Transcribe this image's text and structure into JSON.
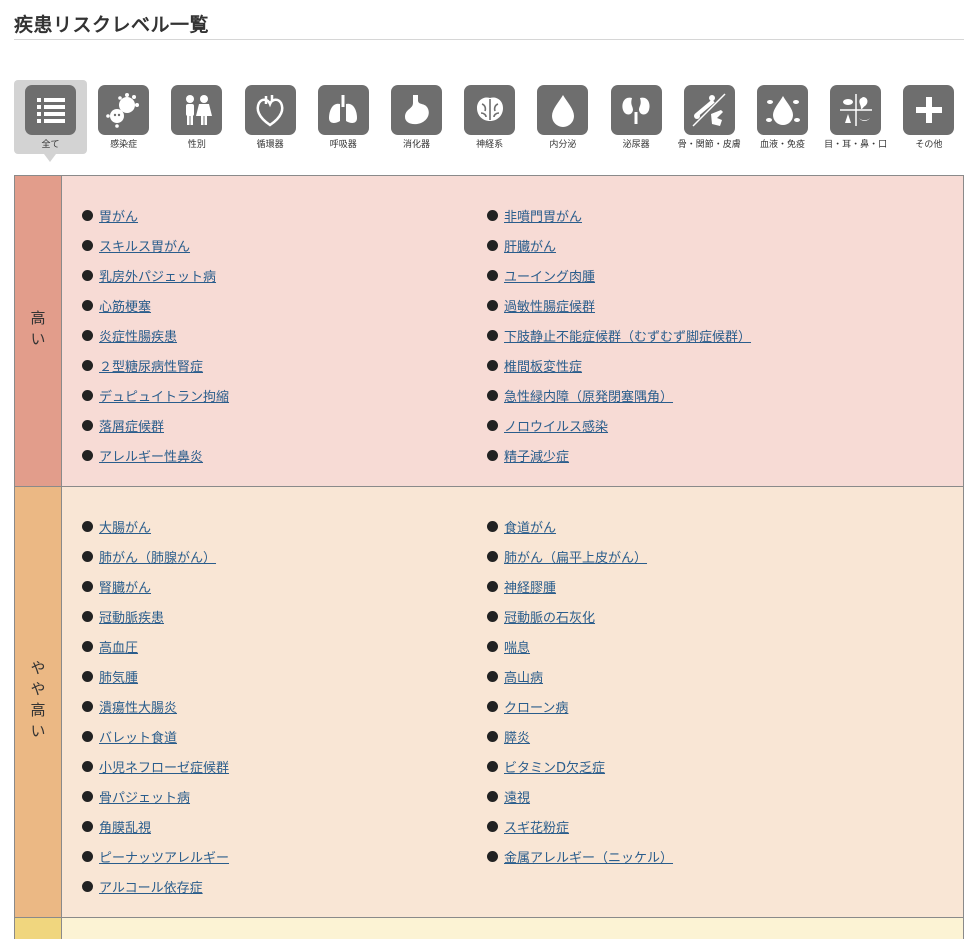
{
  "page": {
    "title": "疾患リスクレベル一覧"
  },
  "categories": [
    {
      "label": "全て",
      "icon": "list-icon",
      "active": true
    },
    {
      "label": "感染症",
      "icon": "virus-icon",
      "active": false
    },
    {
      "label": "性別",
      "icon": "gender-icon",
      "active": false
    },
    {
      "label": "循環器",
      "icon": "heart-icon",
      "active": false
    },
    {
      "label": "呼吸器",
      "icon": "lungs-icon",
      "active": false
    },
    {
      "label": "消化器",
      "icon": "stomach-icon",
      "active": false
    },
    {
      "label": "神経系",
      "icon": "brain-icon",
      "active": false
    },
    {
      "label": "内分泌",
      "icon": "drop-icon",
      "active": false
    },
    {
      "label": "泌尿器",
      "icon": "kidney-icon",
      "active": false
    },
    {
      "label": "骨・関節・皮膚",
      "icon": "bone-hand-icon",
      "active": false
    },
    {
      "label": "血液・免疫",
      "icon": "blood-cell-icon",
      "active": false
    },
    {
      "label": "目・耳・鼻・口",
      "icon": "face-parts-icon",
      "active": false
    },
    {
      "label": "その他",
      "icon": "plus-icon",
      "active": false
    }
  ],
  "risk_levels": {
    "high": {
      "label": "高い",
      "color": "#e29d8b",
      "left": [
        "胃がん",
        "スキルス胃がん",
        "乳房外パジェット病",
        "心筋梗塞",
        "炎症性腸疾患",
        "２型糖尿病性腎症",
        "デュピュイトラン拘縮",
        "落屑症候群",
        "アレルギー性鼻炎"
      ],
      "right": [
        "非噴門胃がん",
        "肝臓がん",
        "ユーイング肉腫",
        "過敏性腸症候群",
        "下肢静止不能症候群（むずむず脚症候群）",
        "椎間板変性症",
        "急性緑内障（原発閉塞隅角）",
        "ノロウイルス感染",
        "精子減少症"
      ]
    },
    "mid": {
      "label": "やや高い",
      "color": "#ebb884",
      "left": [
        "大腸がん",
        "肺がん（肺腺がん）",
        "腎臓がん",
        "冠動脈疾患",
        "高血圧",
        "肺気腫",
        "潰瘍性大腸炎",
        "バレット食道",
        "小児ネフローゼ症候群",
        "骨パジェット病",
        "角膜乱視",
        "ピーナッツアレルギー",
        "アルコール依存症"
      ],
      "right": [
        "食道がん",
        "肺がん（扁平上皮がん）",
        "神経膠腫",
        "冠動脈の石灰化",
        "喘息",
        "高山病",
        "クローン病",
        "膵炎",
        "ビタミンD欠乏症",
        "遠視",
        "スギ花粉症",
        "金属アレルギー（ニッケル）"
      ]
    },
    "low": {
      "color": "#f0d67e"
    }
  }
}
